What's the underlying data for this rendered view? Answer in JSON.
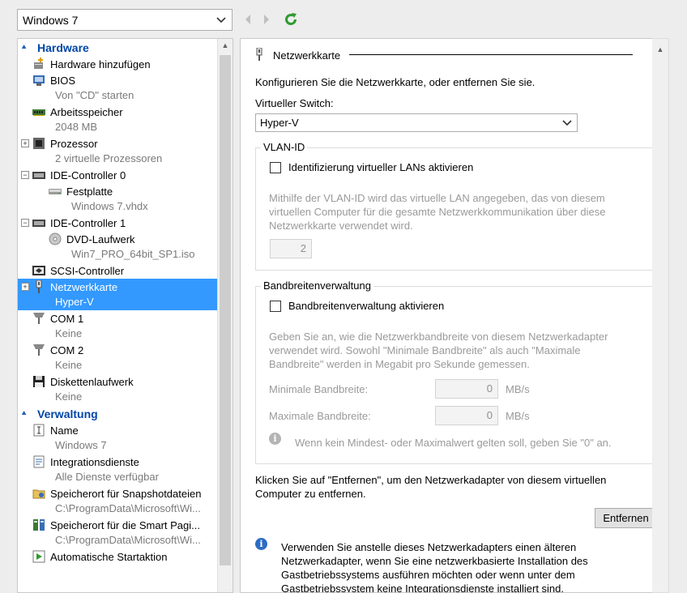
{
  "toolbar": {
    "vm_name": "Windows 7",
    "icons": [
      "chevron-down-icon",
      "back-arrow-icon",
      "forward-arrow-icon",
      "refresh-icon"
    ]
  },
  "hardware_section": {
    "title": "Hardware",
    "items": [
      {
        "label": "Hardware hinzufügen",
        "sub": "",
        "icon": "add-hardware-icon"
      },
      {
        "label": "BIOS",
        "sub": "Von \"CD\" starten",
        "icon": "bios-icon"
      },
      {
        "label": "Arbeitsspeicher",
        "sub": "2048 MB",
        "icon": "memory-icon"
      },
      {
        "label": "Prozessor",
        "sub": "2 virtuelle Prozessoren",
        "icon": "processor-icon"
      },
      {
        "label": "IDE-Controller 0",
        "sub": "",
        "icon": "controller-icon"
      },
      {
        "label": "Festplatte",
        "sub": "Windows 7.vhdx",
        "icon": "hard-disk-icon"
      },
      {
        "label": "IDE-Controller 1",
        "sub": "",
        "icon": "controller-icon"
      },
      {
        "label": "DVD-Laufwerk",
        "sub": "Win7_PRO_64bit_SP1.iso",
        "icon": "dvd-icon"
      },
      {
        "label": "SCSI-Controller",
        "sub": "",
        "icon": "scsi-icon"
      },
      {
        "label": "Netzwerkkarte",
        "sub": "Hyper-V",
        "icon": "network-adapter-icon"
      },
      {
        "label": "COM 1",
        "sub": "Keine",
        "icon": "com-port-icon"
      },
      {
        "label": "COM 2",
        "sub": "Keine",
        "icon": "com-port-icon"
      },
      {
        "label": "Diskettenlaufwerk",
        "sub": "Keine",
        "icon": "floppy-icon"
      }
    ]
  },
  "management_section": {
    "title": "Verwaltung",
    "items": [
      {
        "label": "Name",
        "sub": "Windows 7",
        "icon": "name-icon"
      },
      {
        "label": "Integrationsdienste",
        "sub": "Alle Dienste verfügbar",
        "icon": "integration-services-icon"
      },
      {
        "label": "Speicherort für Snapshotdateien",
        "sub": "C:\\ProgramData\\Microsoft\\Wi...",
        "icon": "snapshot-location-icon"
      },
      {
        "label": "Speicherort für die Smart Pagi...",
        "sub": "C:\\ProgramData\\Microsoft\\Wi...",
        "icon": "smart-paging-icon"
      },
      {
        "label": "Automatische Startaktion",
        "sub": "",
        "icon": "autostart-icon"
      }
    ]
  },
  "detail": {
    "title": "Netzwerkkarte",
    "intro": "Konfigurieren Sie die Netzwerkkarte, oder entfernen Sie sie.",
    "switch_label": "Virtueller Switch:",
    "switch_value": "Hyper-V",
    "vlan": {
      "title": "VLAN-ID",
      "checkbox_label": "Identifizierung virtueller LANs aktivieren",
      "checked": false,
      "desc_lines": [
        "Mithilfe der VLAN-ID wird das virtuelle LAN angegeben, das von diesem",
        "virtuellen Computer für die gesamte Netzwerkkommunikation über diese",
        "Netzwerkkarte verwendet wird."
      ],
      "value": "2"
    },
    "bandwidth": {
      "title": "Bandbreitenverwaltung",
      "checkbox_label": "Bandbreitenverwaltung aktivieren",
      "checked": false,
      "desc_lines": [
        "Geben Sie an, wie die Netzwerkbandbreite von diesem Netzwerkadapter",
        "verwendet wird. Sowohl \"Minimale Bandbreite\" als auch \"Maximale",
        "Bandbreite\" werden in Megabit pro Sekunde gemessen."
      ],
      "min_label": "Minimale Bandbreite:",
      "min_value": "0",
      "max_label": "Maximale Bandbreite:",
      "max_value": "0",
      "unit": "MB/s",
      "hint": "Wenn kein Mindest- oder Maximalwert gelten soll, geben Sie \"0\" an."
    },
    "remove_lines": [
      "Klicken Sie auf \"Entfernen\", um den Netzwerkadapter von diesem virtuellen",
      "Computer zu entfernen."
    ],
    "remove_button": "Entfernen",
    "legacy_lines": [
      "Verwenden Sie anstelle dieses Netzwerkadapters einen älteren",
      "Netzwerkadapter, wenn Sie eine netzwerkbasierte Installation des",
      "Gastbetriebssystems ausführen möchten oder wenn unter dem",
      "Gastbetriebssystem keine Integrationsdienste installiert sind."
    ]
  },
  "colors": {
    "selection": "#3399ff",
    "section_header": "#0046a8",
    "info_icon": "#2d6cc4"
  }
}
